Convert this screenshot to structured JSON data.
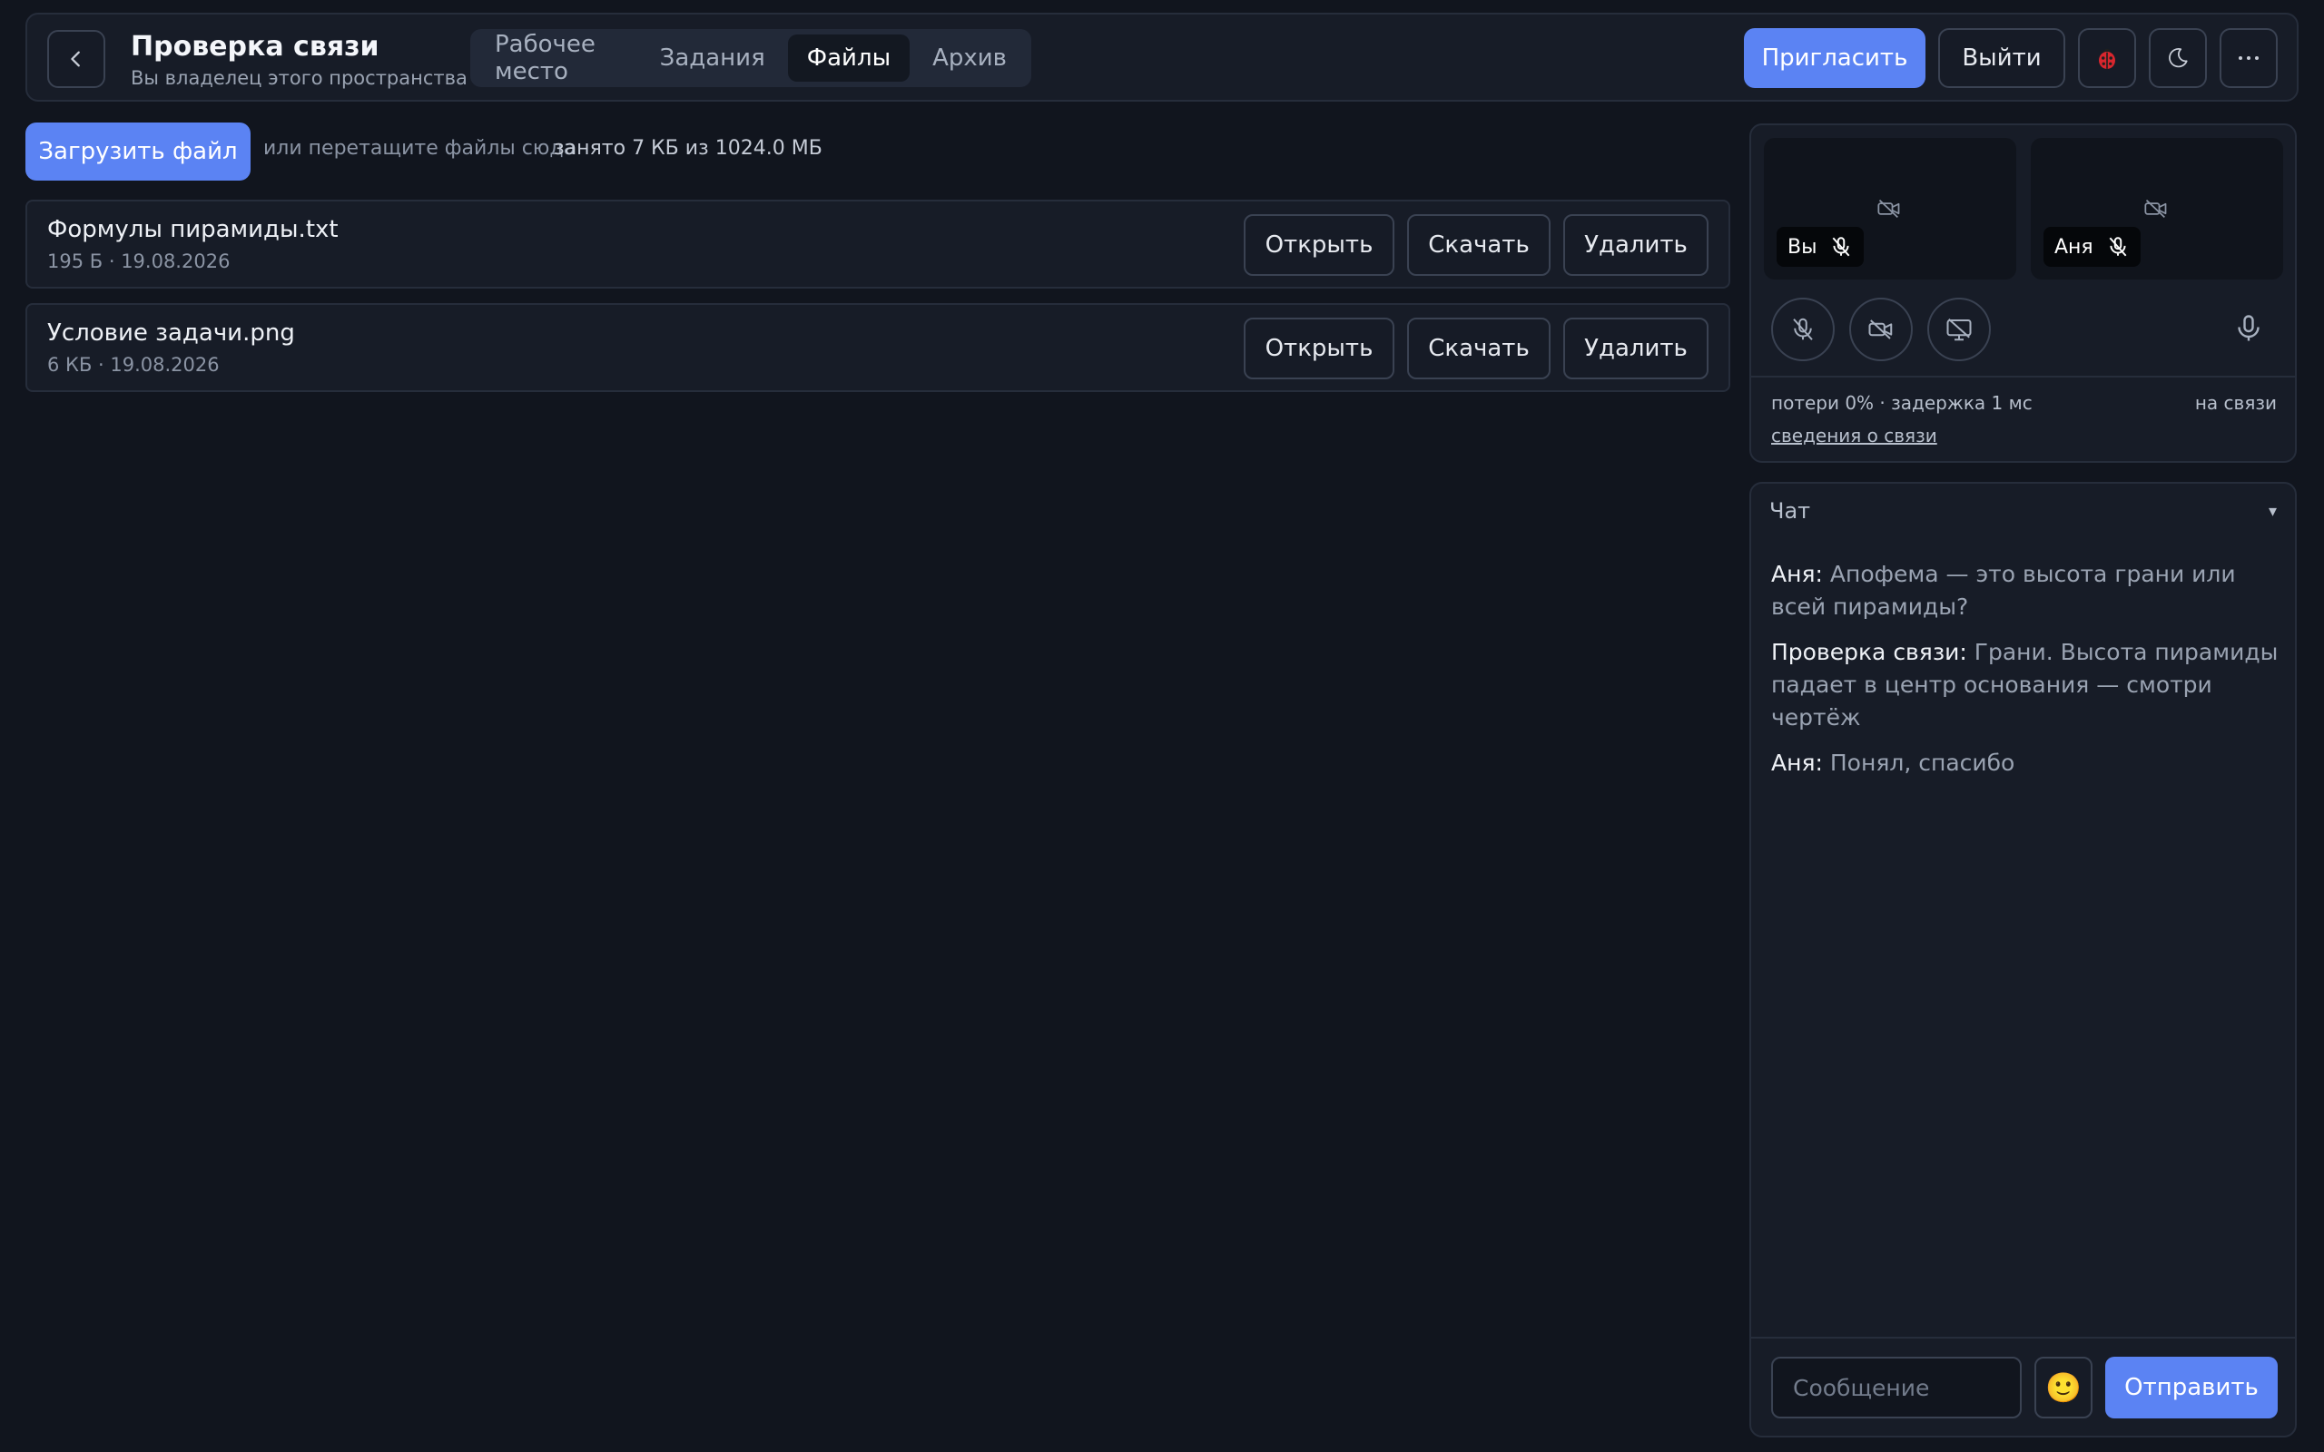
{
  "header": {
    "title": "Проверка связи",
    "subtitle": "Вы владелец этого пространства",
    "tabs": [
      {
        "label": "Рабочее место"
      },
      {
        "label": "Задания"
      },
      {
        "label": "Файлы"
      },
      {
        "label": "Архив"
      }
    ],
    "active_tab": "Файлы",
    "invite_label": "Пригласить",
    "logout_label": "Выйти",
    "icons": {
      "back": "chevron-left-icon",
      "bug": "ladybug-icon",
      "theme": "moon-icon",
      "more": "more-horizontal-icon"
    }
  },
  "files": {
    "upload_label": "Загрузить файл",
    "drop_hint": "или перетащите файлы сюда",
    "storage": "занято 7 КБ из 1024.0 МБ",
    "items": [
      {
        "name": "Формулы пирамиды.txt",
        "meta": "195 Б · 19.08.2026",
        "open": "Открыть",
        "download": "Скачать",
        "delete": "Удалить"
      },
      {
        "name": "Условие задачи.png",
        "meta": "6 КБ · 19.08.2026",
        "open": "Открыть",
        "download": "Скачать",
        "delete": "Удалить"
      }
    ]
  },
  "call": {
    "participants": [
      {
        "name": "Вы",
        "mic": "muted",
        "camera": "off"
      },
      {
        "name": "Аня",
        "mic": "muted",
        "camera": "off"
      }
    ],
    "stats": "потери 0% · задержка 1 мс",
    "status": "на связи",
    "details_link": "сведения о связи"
  },
  "chat": {
    "title": "Чат",
    "toggle": "▾",
    "messages": [
      {
        "author": "Аня:",
        "text": "Апофема — это высота грани или всей пирамиды?"
      },
      {
        "author": "Проверка связи:",
        "text": "Грани. Высота пирамиды падает в центр основания — смотри чертёж"
      },
      {
        "author": "Аня:",
        "text": "Понял, спасибо"
      }
    ],
    "input_placeholder": "Сообщение",
    "emoji": "🙂",
    "send_label": "Отправить"
  },
  "colors": {
    "background": "#11151e",
    "panel": "#171c27",
    "accent": "#5b83f3",
    "border": "#3a4252"
  }
}
